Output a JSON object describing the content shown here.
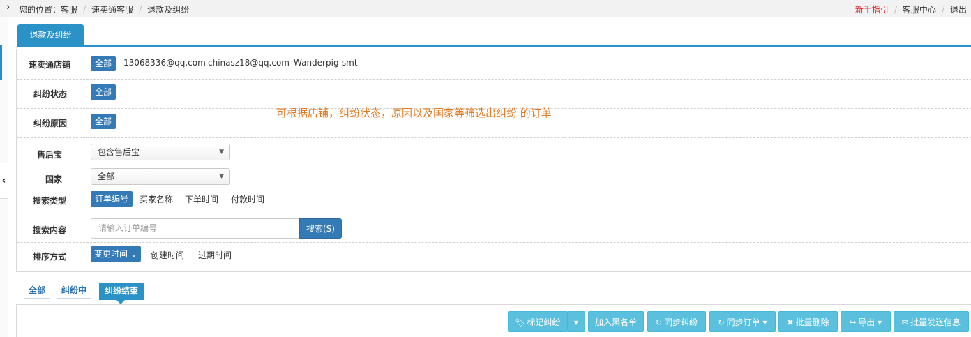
{
  "breadcrumb": {
    "prefix": "您的位置：",
    "items": [
      "客服",
      "速卖通客服",
      "退款及纠纷"
    ]
  },
  "toplinks": {
    "guide": "新手指引",
    "service_center": "客服中心",
    "logout": "退出"
  },
  "tabs": [
    {
      "label": "退款及纠纷",
      "active": true
    }
  ],
  "filters": {
    "store": {
      "label": "速卖通店铺",
      "selected": "全部",
      "options": [
        "13068336@qq.com",
        "chinasz18@qq.com",
        "Wanderpig-smt"
      ]
    },
    "dispute_status": {
      "label": "纠纷状态",
      "selected": "全部"
    },
    "dispute_reason": {
      "label": "纠纷原因",
      "selected": "全部"
    },
    "after_sales": {
      "label": "售后宝",
      "value": "包含售后宝"
    },
    "country": {
      "label": "国家",
      "value": "全部"
    },
    "search_type": {
      "label": "搜索类型",
      "selected": "订单编号",
      "options": [
        "买家名称",
        "下单时间",
        "付款时间"
      ]
    },
    "search_content": {
      "label": "搜索内容",
      "placeholder": "请输入订单编号",
      "button": "搜索(S)"
    },
    "sort": {
      "label": "排序方式",
      "selected": "变更时间",
      "options": [
        "创建时间",
        "过期时间"
      ]
    }
  },
  "note": "可根据店铺，纠纷状态，原因以及国家等筛选出纠纷 的订单",
  "status_tabs": [
    {
      "label": "全部",
      "active": false
    },
    {
      "label": "纠纷中",
      "active": false
    },
    {
      "label": "纠纷结束",
      "active": true
    }
  ],
  "actions": {
    "mark": "标记纠纷",
    "blacklist": "加入黑名单",
    "sync_dispute": "同步纠纷",
    "sync_order": "同步订单",
    "batch_delete": "批量删除",
    "export": "导出",
    "batch_send": "批量发送信息"
  },
  "colors": {
    "primary": "#337ab7",
    "tab_blue": "#2a92c6",
    "action_button": "#5bc0de",
    "note": "#e07b24",
    "guide_link": "#d9282f"
  }
}
